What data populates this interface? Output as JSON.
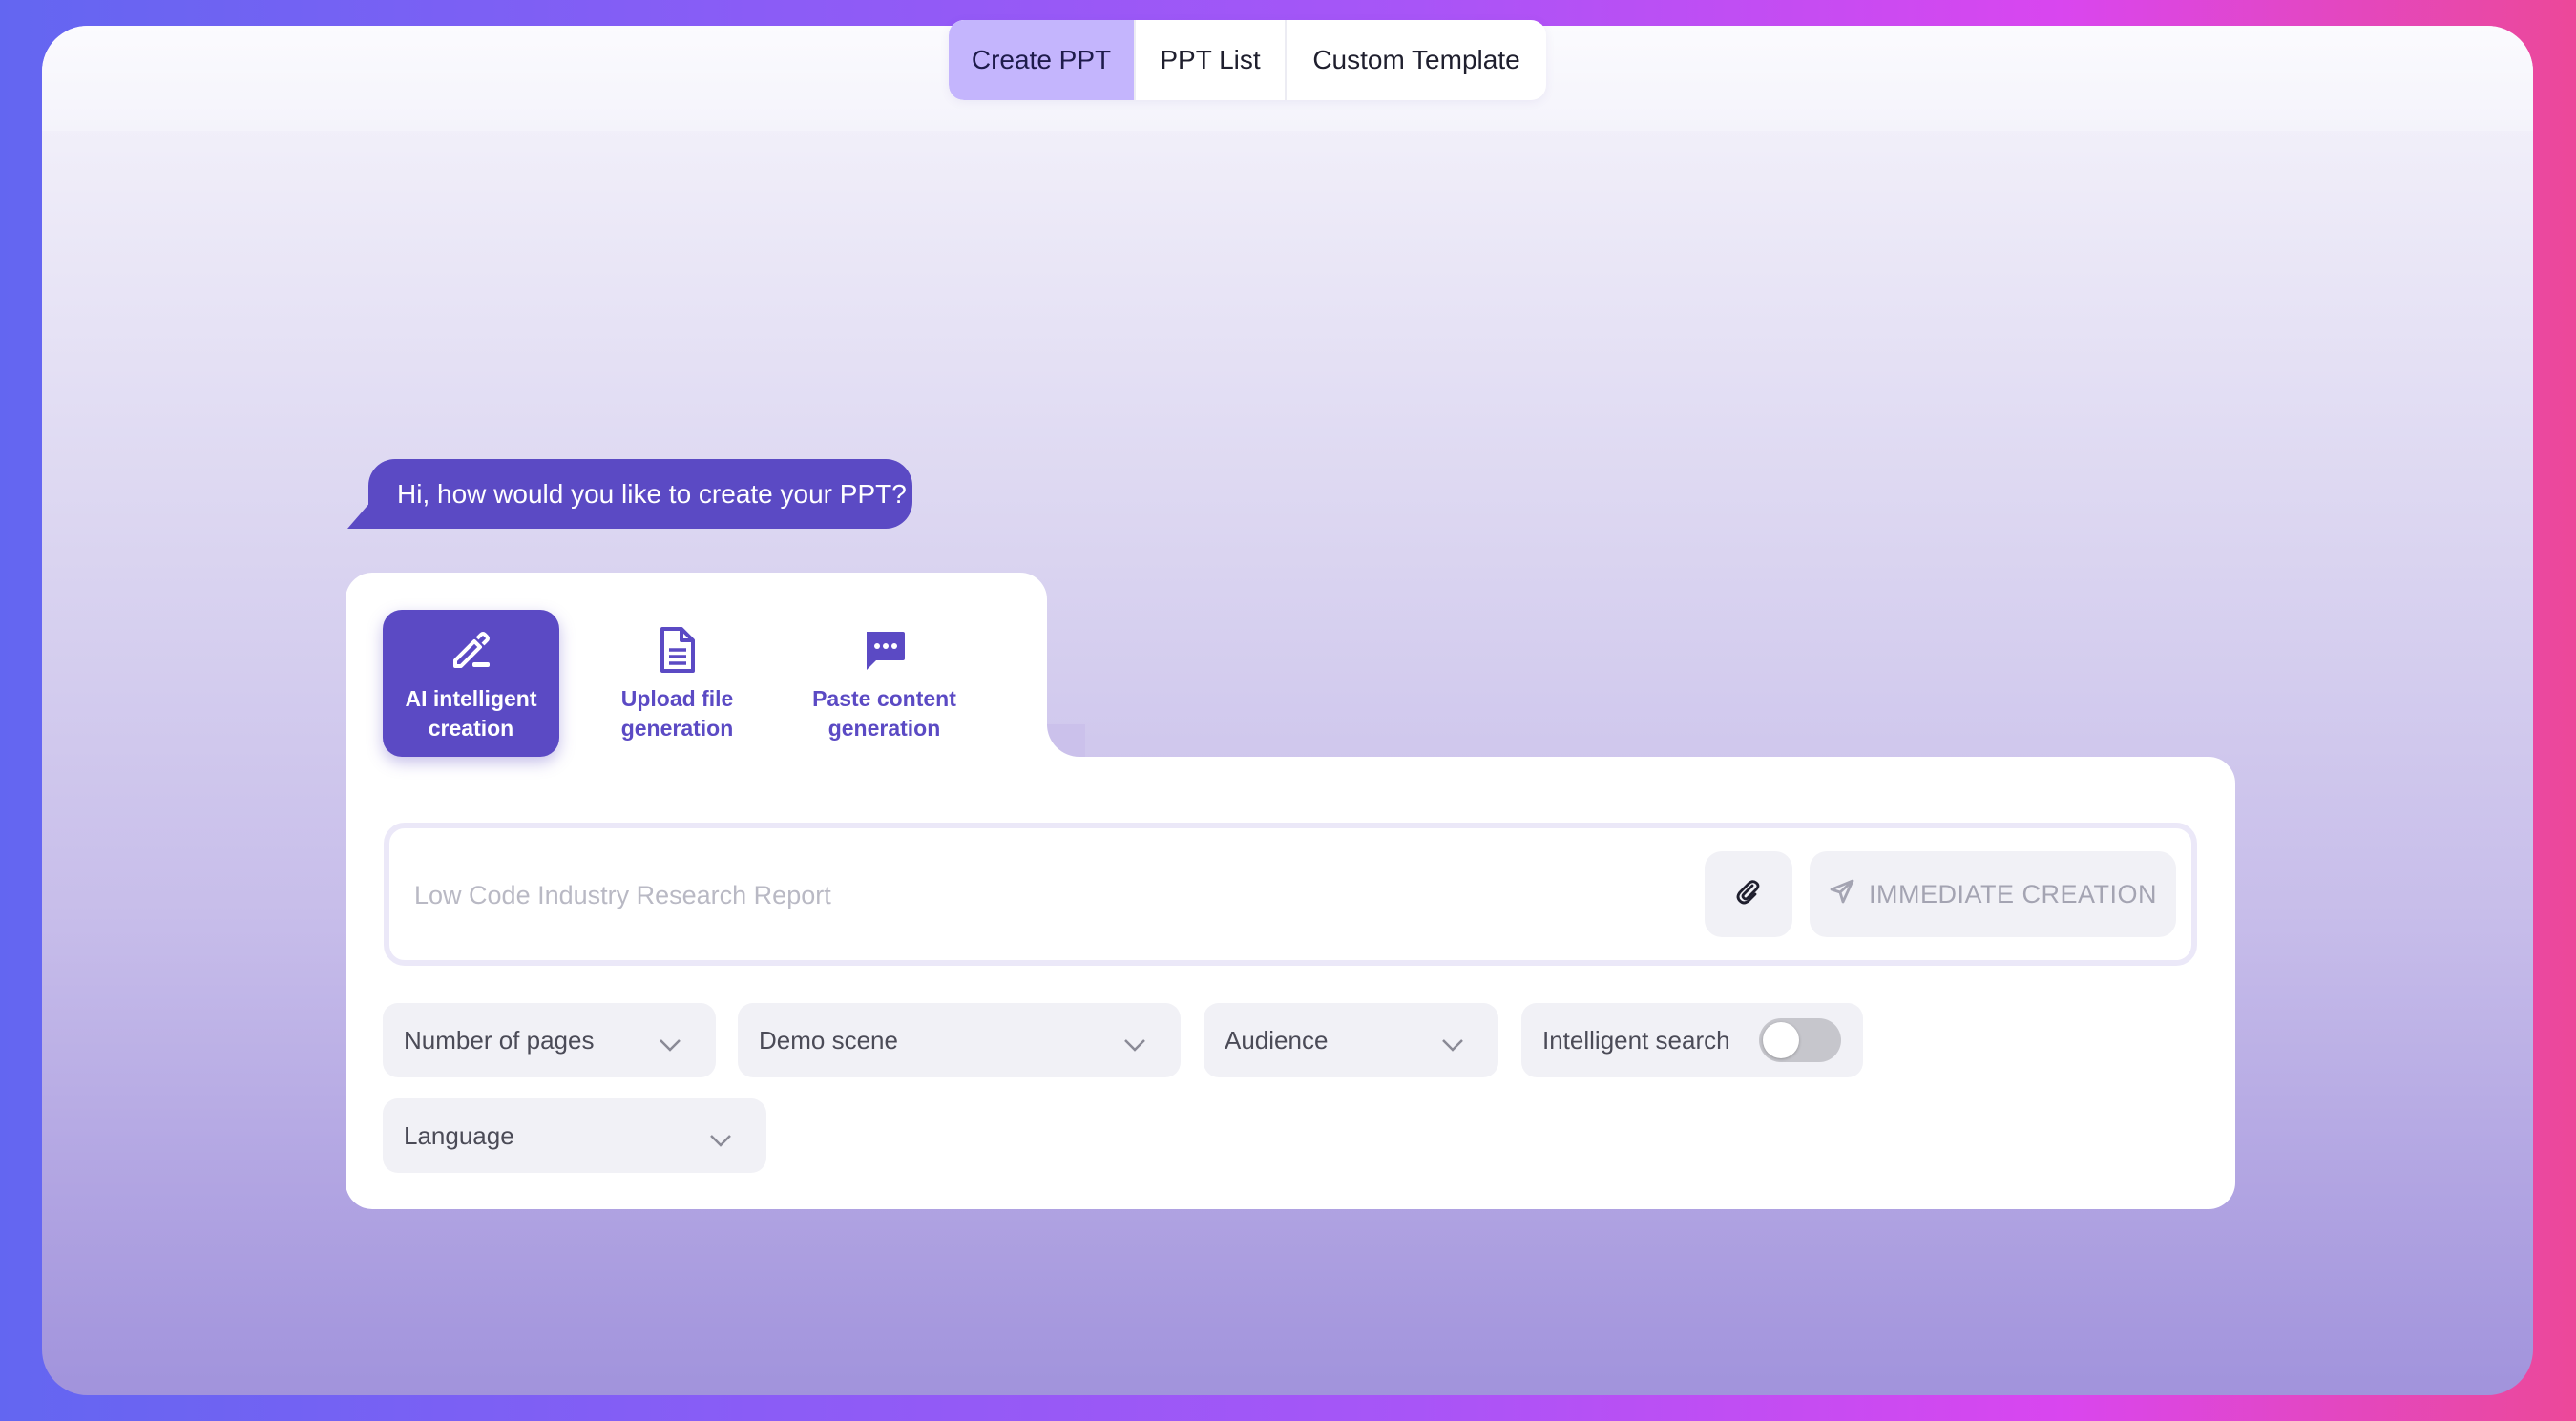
{
  "tabs": [
    {
      "label": "Create PPT",
      "active": true
    },
    {
      "label": "PPT List",
      "active": false
    },
    {
      "label": "Custom Template",
      "active": false
    }
  ],
  "greeting": "Hi, how would you like to create your PPT?",
  "modes": [
    {
      "label": "AI intelligent creation",
      "icon": "pencil-icon",
      "active": true
    },
    {
      "label": "Upload file generation",
      "icon": "document-icon",
      "active": false
    },
    {
      "label": "Paste content generation",
      "icon": "chat-bubble-icon",
      "active": false
    }
  ],
  "prompt": {
    "value": "",
    "placeholder": "Low Code Industry Research Report",
    "attach_icon": "paperclip-icon",
    "create_label": "IMMEDIATE CREATION",
    "create_icon": "send-icon"
  },
  "options": {
    "pages": "Number of pages",
    "scene": "Demo scene",
    "audience": "Audience",
    "search_label": "Intelligent search",
    "search_enabled": false,
    "language": "Language"
  },
  "colors": {
    "accent": "#5b4ac4",
    "active_tab": "#c4b5fd",
    "background_gradient_start": "#6366f1",
    "background_gradient_end": "#ec4899"
  }
}
